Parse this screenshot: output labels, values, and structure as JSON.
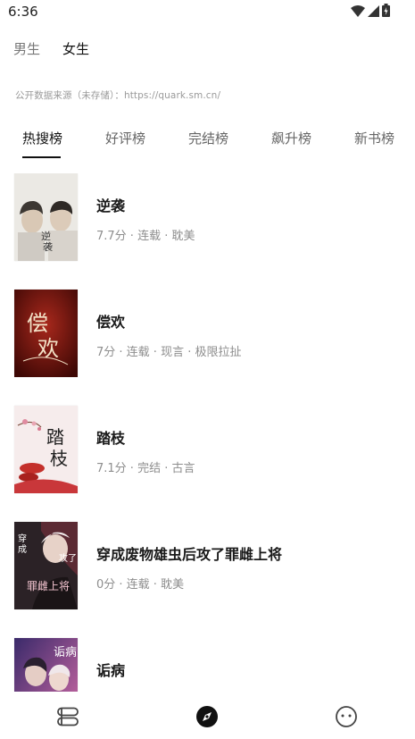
{
  "status_bar": {
    "time": "6:36",
    "icons": [
      "wifi-icon",
      "cellular-signal-icon",
      "battery-icon"
    ]
  },
  "gender_tabs": [
    {
      "label": "男生",
      "active": false
    },
    {
      "label": "女生",
      "active": true
    }
  ],
  "source_note": "公开数据来源（未存储）：https://quark.sm.cn/",
  "rank_tabs": [
    {
      "label": "热搜榜",
      "active": true
    },
    {
      "label": "好评榜",
      "active": false
    },
    {
      "label": "完结榜",
      "active": false
    },
    {
      "label": "飙升榜",
      "active": false
    },
    {
      "label": "新书榜",
      "active": false
    }
  ],
  "books": [
    {
      "title": "逆袭",
      "meta": "7.7分 · 连载 · 耽美",
      "cover_lettering": "逆袭",
      "cover_colors": [
        "#ecebe6",
        "#c7c3bc"
      ]
    },
    {
      "title": "偿欢",
      "meta": "7分 · 连载 · 现言 · 极限拉扯",
      "cover_lettering": "偿欢",
      "cover_colors": [
        "#8f1d14",
        "#4a0a06"
      ]
    },
    {
      "title": "踏枝",
      "meta": "7.1分 · 完结 · 古言",
      "cover_lettering": "踏枝",
      "cover_colors": [
        "#f6ecec",
        "#e9d7d8"
      ]
    },
    {
      "title": "穿成废物雄虫后攻了罪雌上将",
      "meta": "0分 · 连载 · 耽美",
      "cover_lettering": "穿成 雄虫后 攻了 罪雌上将",
      "cover_colors": [
        "#2b2226",
        "#7a2530"
      ]
    },
    {
      "title": "诟病",
      "meta": "",
      "cover_lettering": "诟病",
      "cover_colors": [
        "#3a2a6a",
        "#d06aa6"
      ]
    }
  ],
  "bottom_nav": [
    {
      "icon": "bookshelf-icon",
      "active": false
    },
    {
      "icon": "discover-compass-icon",
      "active": true
    },
    {
      "icon": "profile-face-icon",
      "active": false
    }
  ],
  "colors": {
    "text_primary": "#1a1a1a",
    "text_secondary": "#8e8e8e",
    "tab_inactive": "#666666",
    "accent": "#111111"
  }
}
